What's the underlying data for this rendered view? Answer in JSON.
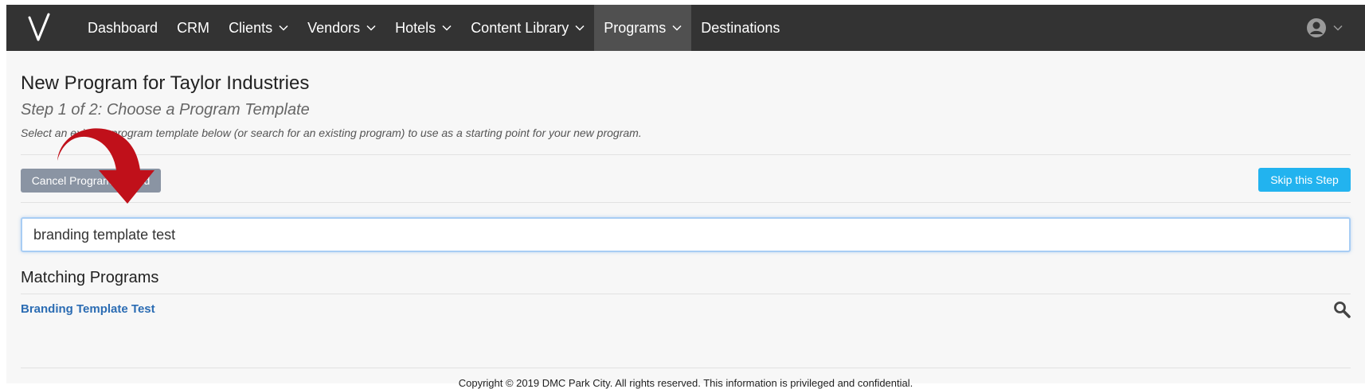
{
  "nav": {
    "items": [
      {
        "label": "Dashboard",
        "has_dropdown": false,
        "active": false
      },
      {
        "label": "CRM",
        "has_dropdown": false,
        "active": false
      },
      {
        "label": "Clients",
        "has_dropdown": true,
        "active": false
      },
      {
        "label": "Vendors",
        "has_dropdown": true,
        "active": false
      },
      {
        "label": "Hotels",
        "has_dropdown": true,
        "active": false
      },
      {
        "label": "Content Library",
        "has_dropdown": true,
        "active": false
      },
      {
        "label": "Programs",
        "has_dropdown": true,
        "active": true
      },
      {
        "label": "Destinations",
        "has_dropdown": false,
        "active": false
      }
    ],
    "logo_icon": "v-logo-icon",
    "user_icon": "user-avatar-icon"
  },
  "page": {
    "title": "New Program for Taylor Industries",
    "step": "Step 1 of 2: Choose a Program Template",
    "description": "Select an existing program template below (or search for an existing program) to use as a starting point for your new program.",
    "cancel_button": "Cancel Program Wizard",
    "skip_button": "Skip this Step",
    "search_value": "branding template test",
    "matching_heading": "Matching Programs",
    "results": [
      {
        "label": "Branding Template Test"
      }
    ]
  },
  "footer": {
    "text": "Copyright © 2019 DMC Park City. All rights reserved. This information is privileged and confidential."
  },
  "colors": {
    "navbar": "#333333",
    "active_nav": "#505050",
    "skip_button": "#22b3ef",
    "cancel_button": "#8a94a3",
    "link": "#2b6cb3",
    "annotation_arrow": "#c0101a"
  }
}
